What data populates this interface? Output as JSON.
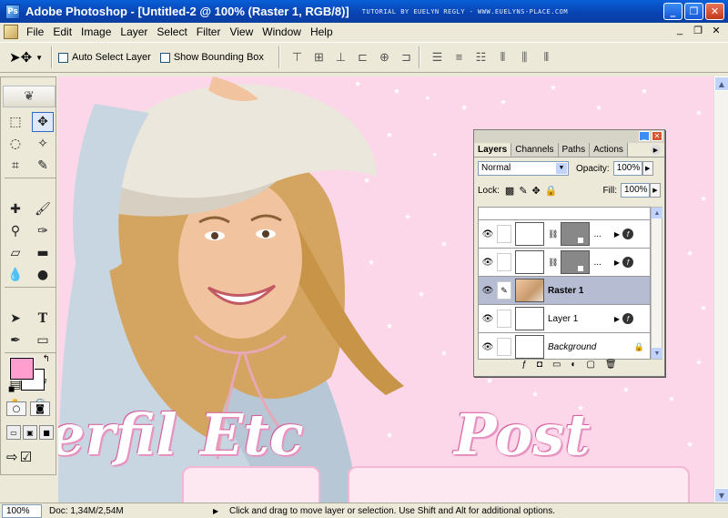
{
  "window": {
    "title": "Adobe Photoshop - [Untitled-2 @ 100% (Raster 1, RGB/8)]",
    "credit": "TUTORIAL BY EUELYN REGLY - WWW.EUELYNS-PLACE.COM",
    "minimize": "_",
    "restore": "❐",
    "close": "✕"
  },
  "menu": {
    "items": [
      "File",
      "Edit",
      "Image",
      "Layer",
      "Select",
      "Filter",
      "View",
      "Window",
      "Help"
    ],
    "doc_minimize": "_",
    "doc_restore": "❐",
    "doc_close": "✕"
  },
  "options": {
    "auto_select_label": "Auto Select Layer",
    "bounding_box_label": "Show Bounding Box"
  },
  "canvas": {
    "background_color": "#fcd6e9",
    "titles": [
      "erfil",
      "Etc",
      "Post"
    ]
  },
  "status": {
    "zoom": "100%",
    "doc_size": "Doc: 1,34M/2,54M",
    "message": "Click and drag to move layer or selection.  Use Shift and Alt for additional options."
  },
  "layers_panel": {
    "tabs": [
      "Layers",
      "Channels",
      "Paths",
      "Actions"
    ],
    "blend_mode": "Normal",
    "opacity_label": "Opacity:",
    "opacity_value": "100%",
    "lock_label": "Lock:",
    "fill_label": "Fill:",
    "fill_value": "100%",
    "layers": [
      {
        "name": "...",
        "type": "adjustment"
      },
      {
        "name": "...",
        "type": "adjustment"
      },
      {
        "name": "Raster 1",
        "type": "photo",
        "selected": true
      },
      {
        "name": "Layer 1",
        "type": "fill"
      },
      {
        "name": "Background",
        "type": "background"
      }
    ]
  },
  "colors": {
    "foreground": "#ff9ecf",
    "background": "#ffffff",
    "title_bar": "#0842b0",
    "selection": "#b6bdd2"
  }
}
